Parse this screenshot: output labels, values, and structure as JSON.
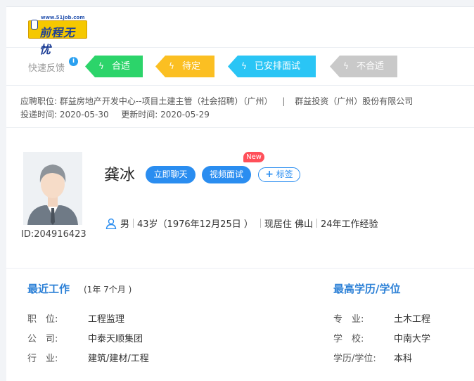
{
  "header": {
    "logo_site": "www.51job.com",
    "logo_text": "前程无忧"
  },
  "feedback": {
    "label": "快速反馈",
    "info_icon": "i",
    "buttons": [
      {
        "label": "合适",
        "color": "#2cd46a"
      },
      {
        "label": "待定",
        "color": "#fbbf22"
      },
      {
        "label": "已安排面试",
        "color": "#2ac5f5"
      },
      {
        "label": "不合适",
        "color": "#c9c9c9"
      }
    ]
  },
  "job": {
    "position_label": "应聘职位:",
    "position": "群益房地产开发中心--项目土建主管（社会招聘）（广州）",
    "separator": "|",
    "company": "群益投资（广州）股份有限公司",
    "apply_label": "投递时间:",
    "apply_date": "2020-05-30",
    "update_label": "更新时间:",
    "update_date": "2020-05-29"
  },
  "profile": {
    "id_text": "ID:204916423",
    "name": "龚冰",
    "chat_label": "立即聊天",
    "video_label": "视频面试",
    "new_badge": "New",
    "tag_plus": "+",
    "tag_label": "标签",
    "gender": "男",
    "age": "43岁（1976年12月25日 ）",
    "residence": "现居住 佛山",
    "experience": "24年工作经验"
  },
  "recent_work": {
    "title": "最近工作",
    "duration": "(1年 7个月 )",
    "rows": [
      {
        "label": "职　位:",
        "value": "工程监理"
      },
      {
        "label": "公　司:",
        "value": "中泰天顺集团"
      },
      {
        "label": "行　业:",
        "value": "建筑/建材/工程"
      }
    ]
  },
  "education": {
    "title": "最高学历/学位",
    "rows": [
      {
        "label": "专　业:",
        "value": "土木工程"
      },
      {
        "label": "学　校:",
        "value": "中南大学"
      },
      {
        "label": "学历/学位:",
        "value": "本科"
      }
    ]
  }
}
